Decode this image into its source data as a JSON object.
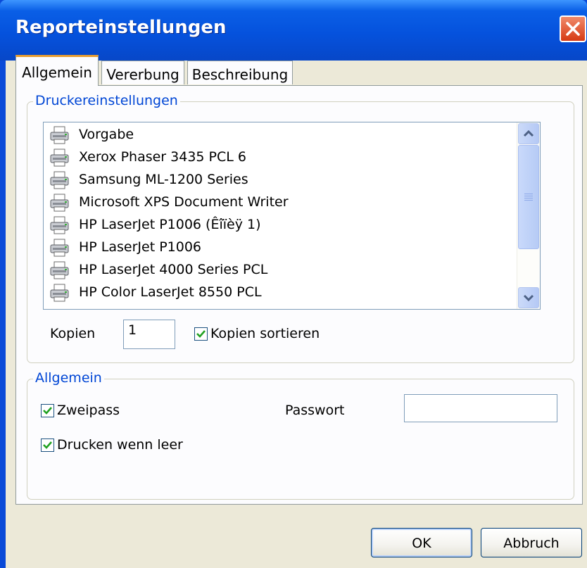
{
  "window": {
    "title": "Reporteinstellungen"
  },
  "tabs": [
    {
      "label": "Allgemein"
    },
    {
      "label": "Vererbung"
    },
    {
      "label": "Beschreibung"
    }
  ],
  "printer_group": {
    "legend": "Druckereinstellungen",
    "printers": [
      "Vorgabe",
      "Xerox Phaser 3435 PCL 6",
      "Samsung ML-1200 Series",
      "Microsoft XPS Document Writer",
      "HP LaserJet P1006 (Êîïèÿ 1)",
      "HP LaserJet P1006",
      "HP LaserJet 4000 Series PCL",
      "HP Color LaserJet 8550 PCL"
    ],
    "copies_label": "Kopien",
    "copies_value": "1",
    "collate_label": "Kopien sortieren",
    "collate_checked": true
  },
  "general_group": {
    "legend": "Allgemein",
    "twopass_label": "Zweipass",
    "twopass_checked": true,
    "print_if_empty_label": "Drucken wenn leer",
    "print_if_empty_checked": true,
    "password_label": "Passwort",
    "password_value": ""
  },
  "buttons": {
    "ok": "OK",
    "cancel": "Abbruch"
  },
  "colors": {
    "titlebar": "#0552dd",
    "tab_accent": "#e89d30",
    "legend": "#0046d5",
    "dialog_bg": "#ece9d8"
  }
}
